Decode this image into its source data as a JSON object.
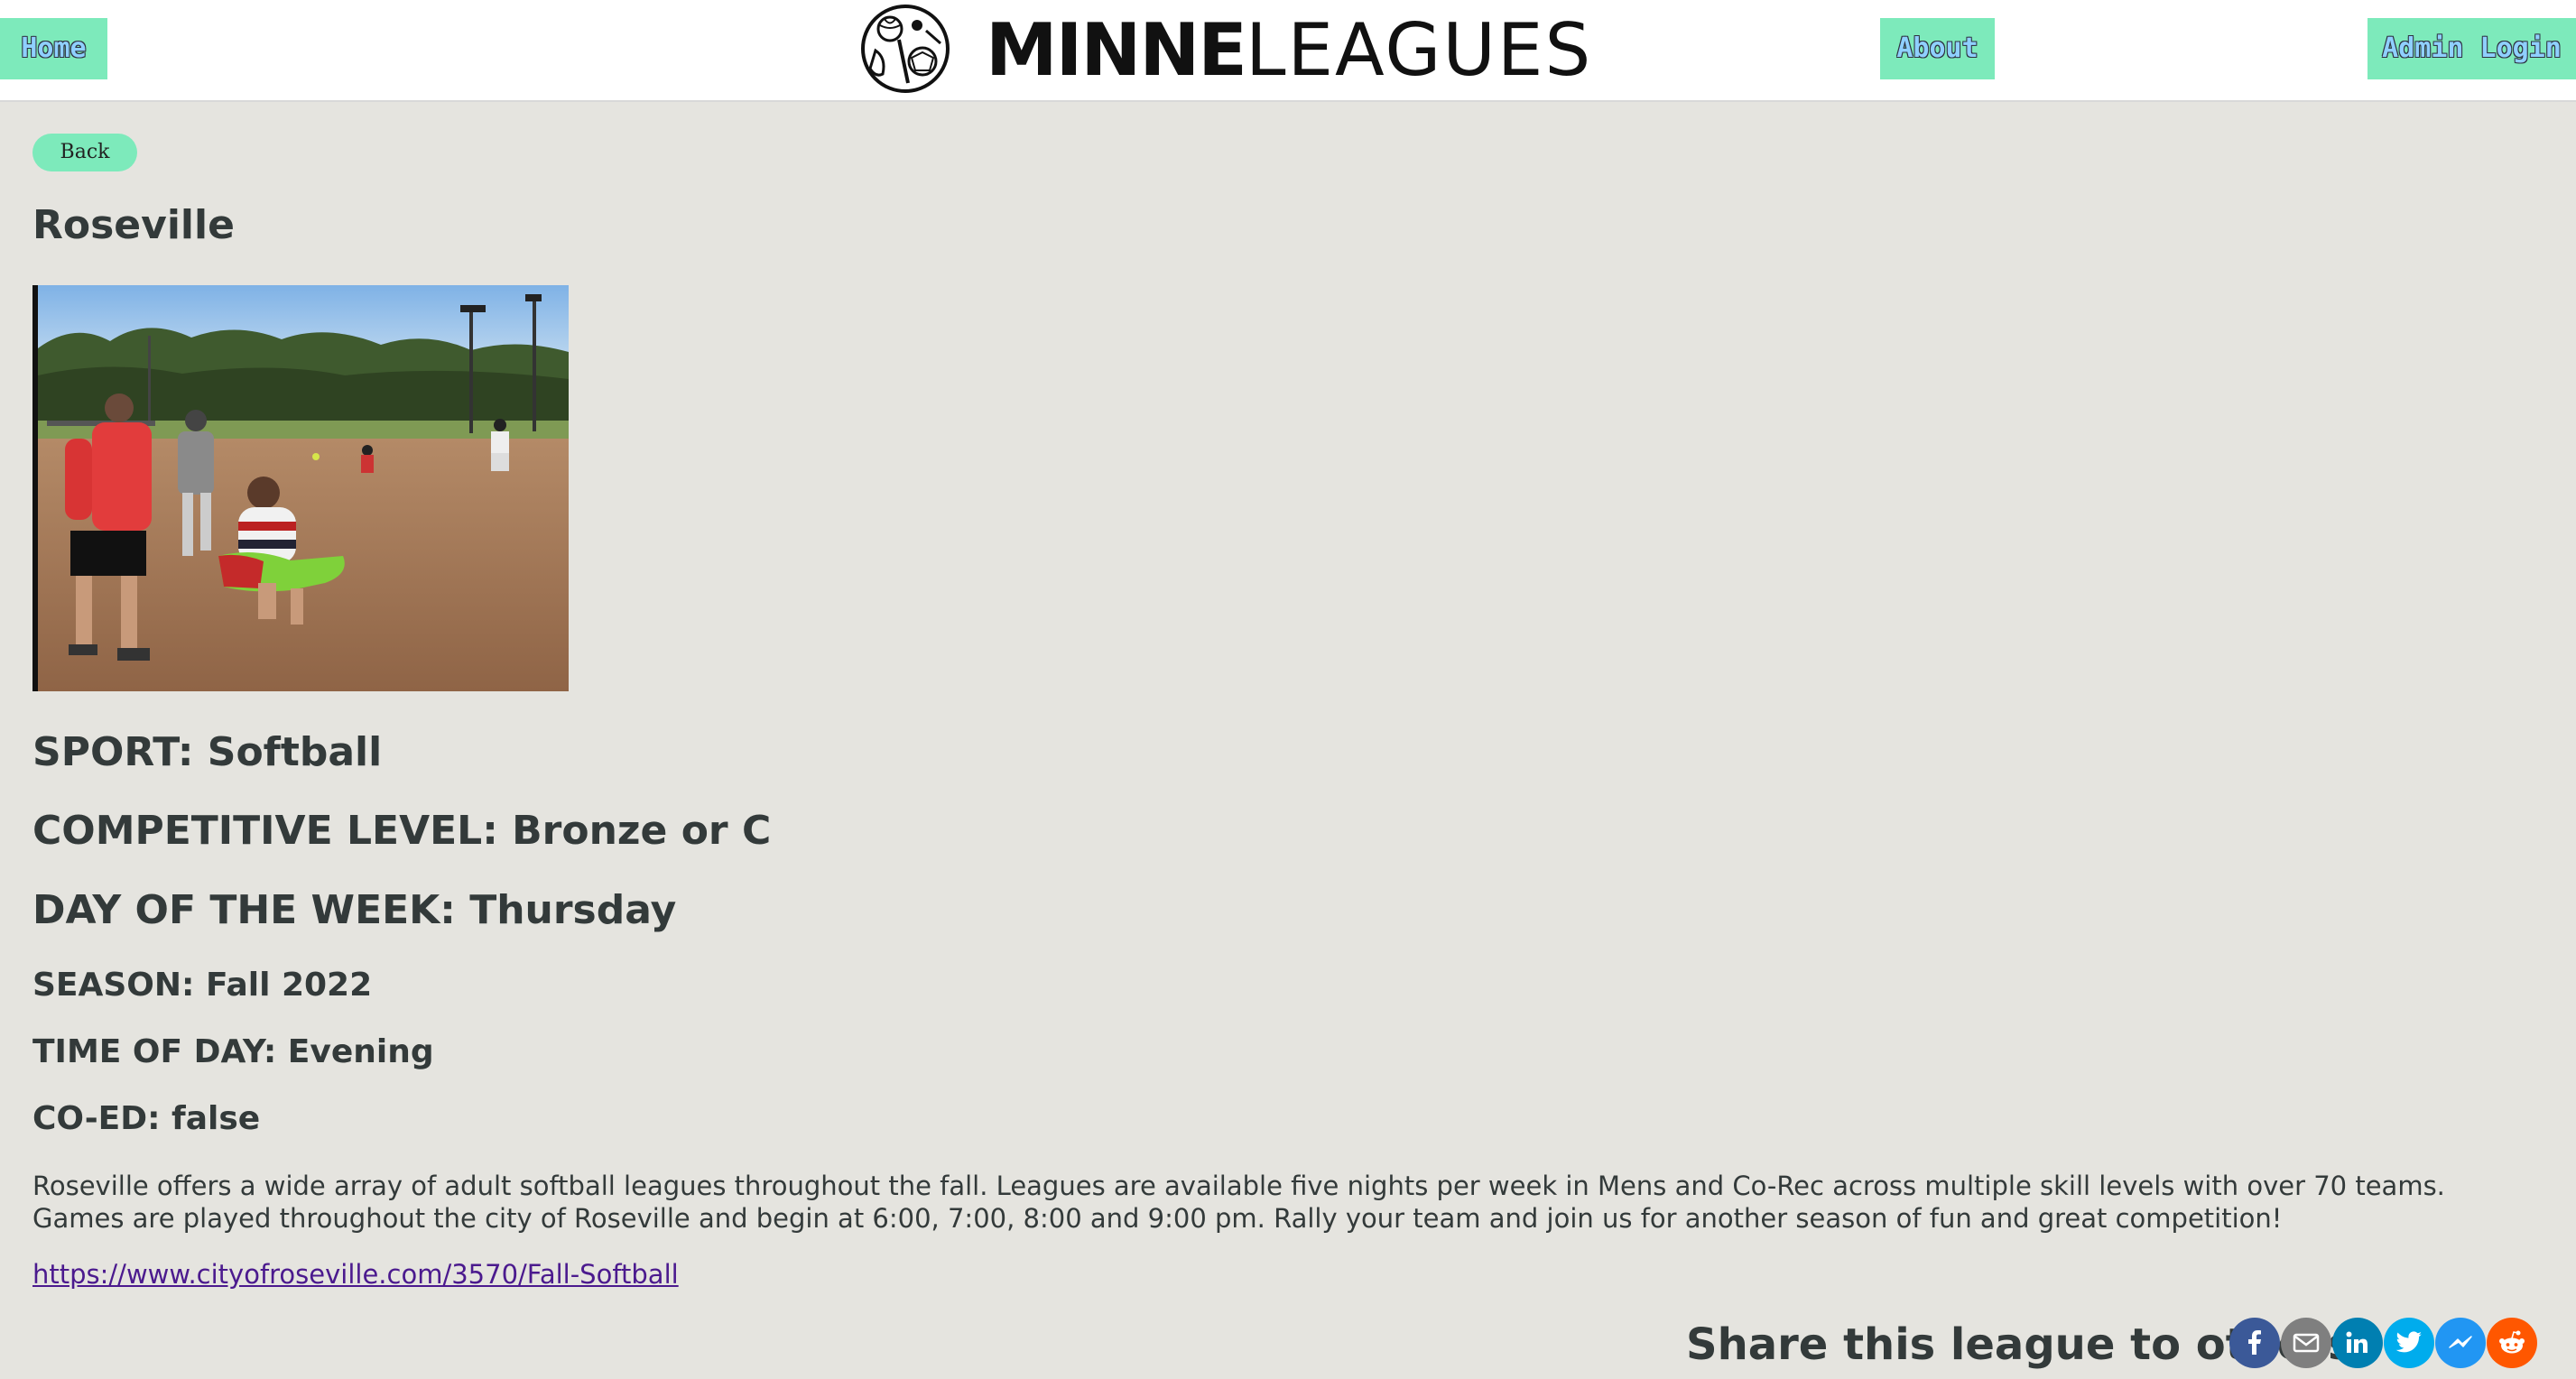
{
  "nav": {
    "home_label": "Home",
    "about_label": "About",
    "admin_label": "Admin Login",
    "logo_bold": "MINNE",
    "logo_light": "LEAGUES"
  },
  "main": {
    "back_label": "Back",
    "league_name": "Roseville",
    "sport": "SPORT: Softball",
    "competitive_level": "COMPETITIVE LEVEL: Bronze or C",
    "day_of_week": "DAY OF THE WEEK: Thursday",
    "season": "SEASON: Fall 2022",
    "time_of_day": "TIME OF DAY: Evening",
    "coed": "CO-ED: false",
    "description": "Roseville offers a wide array of adult softball leagues throughout the fall. Leagues are available five nights per week in Mens and Co-Rec across multiple skill levels with over 70 teams. Games are played throughout the city of Roseville and begin at 6:00, 7:00, 8:00 and 9:00 pm. Rally your team and join us for another season of fun and great competition!",
    "link": "https://www.cityofroseville.com/3570/Fall-Softball"
  },
  "share": {
    "label": "Share this league to others!",
    "icons": [
      {
        "name": "facebook-icon",
        "color": "#3b5998"
      },
      {
        "name": "email-icon",
        "color": "#7f7f7f"
      },
      {
        "name": "linkedin-icon",
        "color": "#007fb1"
      },
      {
        "name": "twitter-icon",
        "color": "#00aced"
      },
      {
        "name": "messenger-icon",
        "color": "#2196f3"
      },
      {
        "name": "reddit-icon",
        "color": "#ff5700"
      }
    ]
  },
  "colors": {
    "accent": "#7deabb",
    "page_bg": "#e5e4df",
    "text": "#333a3a",
    "link": "#4b1a8e"
  }
}
